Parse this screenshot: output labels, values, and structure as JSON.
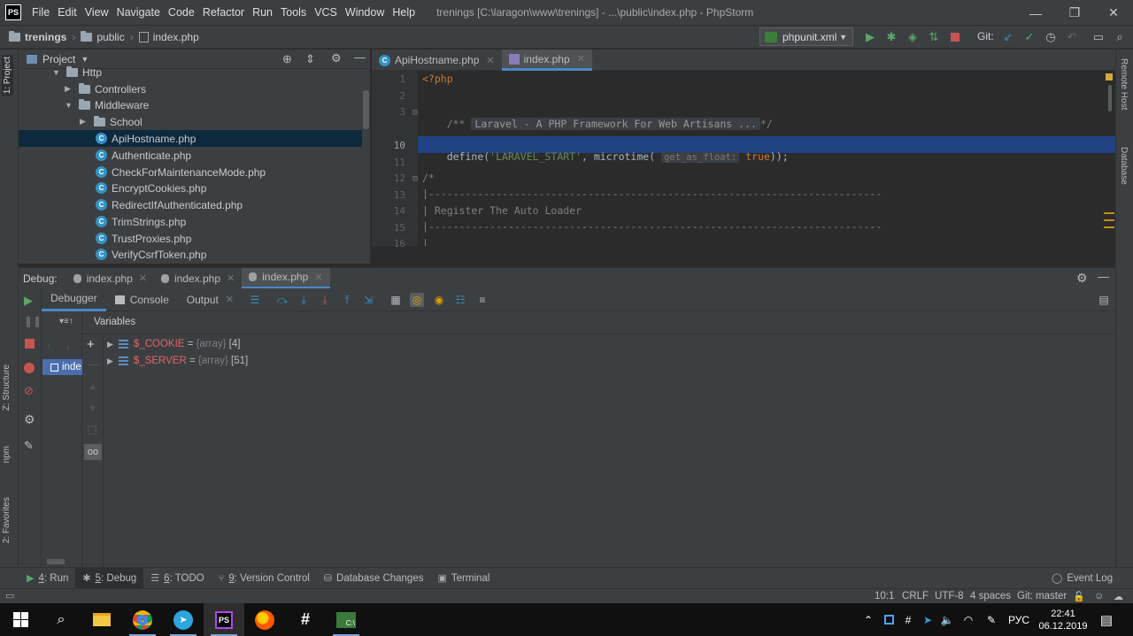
{
  "window": {
    "app_logo": "PS",
    "title": "trenings [C:\\laragon\\www\\trenings] - ...\\public\\index.php - PhpStorm",
    "menu": [
      "File",
      "Edit",
      "View",
      "Navigate",
      "Code",
      "Refactor",
      "Run",
      "Tools",
      "VCS",
      "Window",
      "Help"
    ],
    "controls": {
      "minimize": "—",
      "restore": "❐",
      "close": "✕"
    }
  },
  "navbar": {
    "crumbs": [
      "trenings",
      "public",
      "index.php"
    ],
    "run_config": "phpunit.xml",
    "git_label": "Git:"
  },
  "left_strip": {
    "project": "1: Project",
    "structure": "Z: Structure",
    "npm": "npm",
    "favorites": "2: Favorites"
  },
  "right_strip": {
    "remote_host": "Remote Host",
    "database": "Database"
  },
  "project": {
    "title": "Project",
    "tree": [
      {
        "label": "Http",
        "kind": "folder",
        "expanded": true
      },
      {
        "label": "Controllers",
        "kind": "folder",
        "expanded": false
      },
      {
        "label": "Middleware",
        "kind": "folder",
        "expanded": true
      },
      {
        "label": "School",
        "kind": "folder",
        "expanded": false
      },
      {
        "label": "ApiHostname.php",
        "kind": "php",
        "selected": true
      },
      {
        "label": "Authenticate.php",
        "kind": "php"
      },
      {
        "label": "CheckForMaintenanceMode.php",
        "kind": "php"
      },
      {
        "label": "EncryptCookies.php",
        "kind": "php"
      },
      {
        "label": "RedirectIfAuthenticated.php",
        "kind": "php"
      },
      {
        "label": "TrimStrings.php",
        "kind": "php"
      },
      {
        "label": "TrustProxies.php",
        "kind": "php"
      },
      {
        "label": "VerifyCsrfToken.php",
        "kind": "php"
      }
    ]
  },
  "editor": {
    "tabs": [
      {
        "label": "ApiHostname.php",
        "active": false
      },
      {
        "label": "index.php",
        "active": true
      }
    ],
    "line_numbers": [
      "1",
      "2",
      "3",
      "10",
      "11",
      "12",
      "13",
      "14",
      "15",
      "16"
    ],
    "code": {
      "l1": "<?php",
      "l3_open": "/**",
      "l3_fold": "Laravel - A PHP Framework For Web Artisans ...",
      "l3_close": "*/",
      "l10_fn": "define(",
      "l10_str": "'LARAVEL_START'",
      "l10_mid": ", microtime(",
      "l10_hint": "get_as_float:",
      "l10_true": "true",
      "l10_end": "));",
      "l12": "/*",
      "l13": "|--------------------------------------------------------------------------",
      "l14": "| Register The Auto Loader",
      "l15": "|--------------------------------------------------------------------------",
      "l16": "|"
    }
  },
  "debug": {
    "label": "Debug:",
    "sessions": [
      {
        "label": "index.php",
        "active": false
      },
      {
        "label": "index.php",
        "active": false
      },
      {
        "label": "index.php",
        "active": true
      }
    ],
    "tabs": {
      "debugger": "Debugger",
      "console": "Console",
      "output": "Output"
    },
    "variables_header": "Variables",
    "frame_label": "inde",
    "variables": [
      {
        "name": "$_COOKIE",
        "eq": " = ",
        "type": "{array}",
        "count": " [4]"
      },
      {
        "name": "$_SERVER",
        "eq": " = ",
        "type": "{array}",
        "count": " [51]"
      }
    ]
  },
  "bottom_tabs": [
    {
      "num": "4",
      "label": ": Run",
      "active": false
    },
    {
      "num": "5",
      "label": ": Debug",
      "active": true
    },
    {
      "num": "6",
      "label": ": TODO",
      "active": false
    },
    {
      "num": "9",
      "label": ": Version Control",
      "active": false
    },
    {
      "num": "",
      "label": "Database Changes",
      "active": false
    },
    {
      "num": "",
      "label": "Terminal",
      "active": false
    }
  ],
  "event_log": "Event Log",
  "status": {
    "position": "10:1",
    "line_sep": "CRLF",
    "encoding": "UTF-8",
    "indent": "4 spaces",
    "git": "Git: master"
  },
  "taskbar": {
    "lang": "РУС",
    "time": "22:41",
    "date": "06.12.2019",
    "apps": [
      "windows-start",
      "search",
      "file-explorer",
      "chrome",
      "telegram",
      "phpstorm",
      "opera-like",
      "slack",
      "terminal"
    ]
  },
  "colors": {
    "accent": "#4a88c7",
    "panel": "#3c3f41",
    "editor": "#2b2b2b",
    "selection": "#214283"
  }
}
